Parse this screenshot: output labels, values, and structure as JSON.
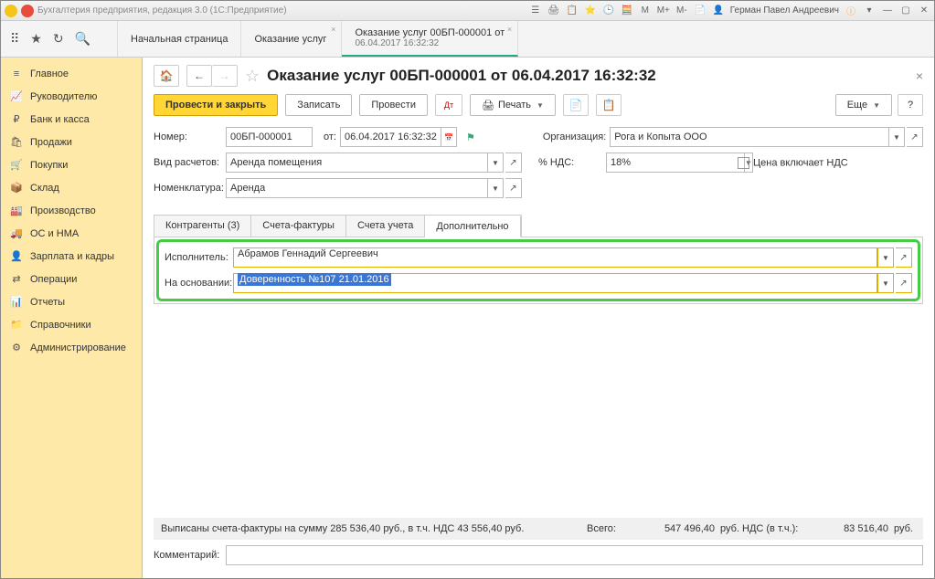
{
  "titlebar": {
    "app_title": "Бухгалтерия предприятия, редакция 3.0  (1С:Предприятие)",
    "user": "Герман Павел Андреевич",
    "m_buttons": [
      "M",
      "M+",
      "M-"
    ]
  },
  "app_tabs": {
    "t1": "Начальная страница",
    "t2": "Оказание услуг",
    "t3_l1": "Оказание услуг 00БП-000001 от",
    "t3_l2": "06.04.2017 16:32:32"
  },
  "sidebar": [
    {
      "icon": "≡",
      "label": "Главное"
    },
    {
      "icon": "📈",
      "label": "Руководителю"
    },
    {
      "icon": "₽",
      "label": "Банк и касса"
    },
    {
      "icon": "🛍",
      "label": "Продажи"
    },
    {
      "icon": "🛒",
      "label": "Покупки"
    },
    {
      "icon": "📦",
      "label": "Склад"
    },
    {
      "icon": "🏭",
      "label": "Производство"
    },
    {
      "icon": "🚚",
      "label": "ОС и НМА"
    },
    {
      "icon": "👤",
      "label": "Зарплата и кадры"
    },
    {
      "icon": "⇄",
      "label": "Операции"
    },
    {
      "icon": "📊",
      "label": "Отчеты"
    },
    {
      "icon": "📁",
      "label": "Справочники"
    },
    {
      "icon": "⚙",
      "label": "Администрирование"
    }
  ],
  "page": {
    "title": "Оказание услуг 00БП-000001 от 06.04.2017 16:32:32",
    "close_x": "×"
  },
  "toolbar": {
    "post_close": "Провести и закрыть",
    "save": "Записать",
    "post": "Провести",
    "print": "Печать",
    "more": "Еще",
    "help": "?"
  },
  "form": {
    "number_lbl": "Номер:",
    "number_val": "00БП-000001",
    "from_lbl": "от:",
    "date_val": "06.04.2017 16:32:32",
    "org_lbl": "Организация:",
    "org_val": "Рога и Копыта ООО",
    "calc_lbl": "Вид расчетов:",
    "calc_val": "Аренда помещения",
    "vat_lbl": "% НДС:",
    "vat_val": "18%",
    "price_incl_lbl": "Цена включает НДС",
    "nomen_lbl": "Номенклатура:",
    "nomen_val": "Аренда"
  },
  "doc_tabs": {
    "t1": "Контрагенты (3)",
    "t2": "Счета-фактуры",
    "t3": "Счета учета",
    "t4": "Дополнительно"
  },
  "extra": {
    "performer_lbl": "Исполнитель:",
    "performer_val": "Абрамов Геннадий Сергеевич",
    "basis_lbl": "На основании:",
    "basis_val": "Доверенность №107 21.01.2016"
  },
  "footer": {
    "invoice_text": "Выписаны счета-фактуры на сумму 285 536,40 руб., в т.ч. НДС 43 556,40 руб.",
    "total_lbl": "Всего:",
    "total_val": "547 496,40",
    "rub": "руб.",
    "vat_lbl": "НДС (в т.ч.):",
    "vat_val": "83 516,40",
    "comment_lbl": "Комментарий:"
  }
}
